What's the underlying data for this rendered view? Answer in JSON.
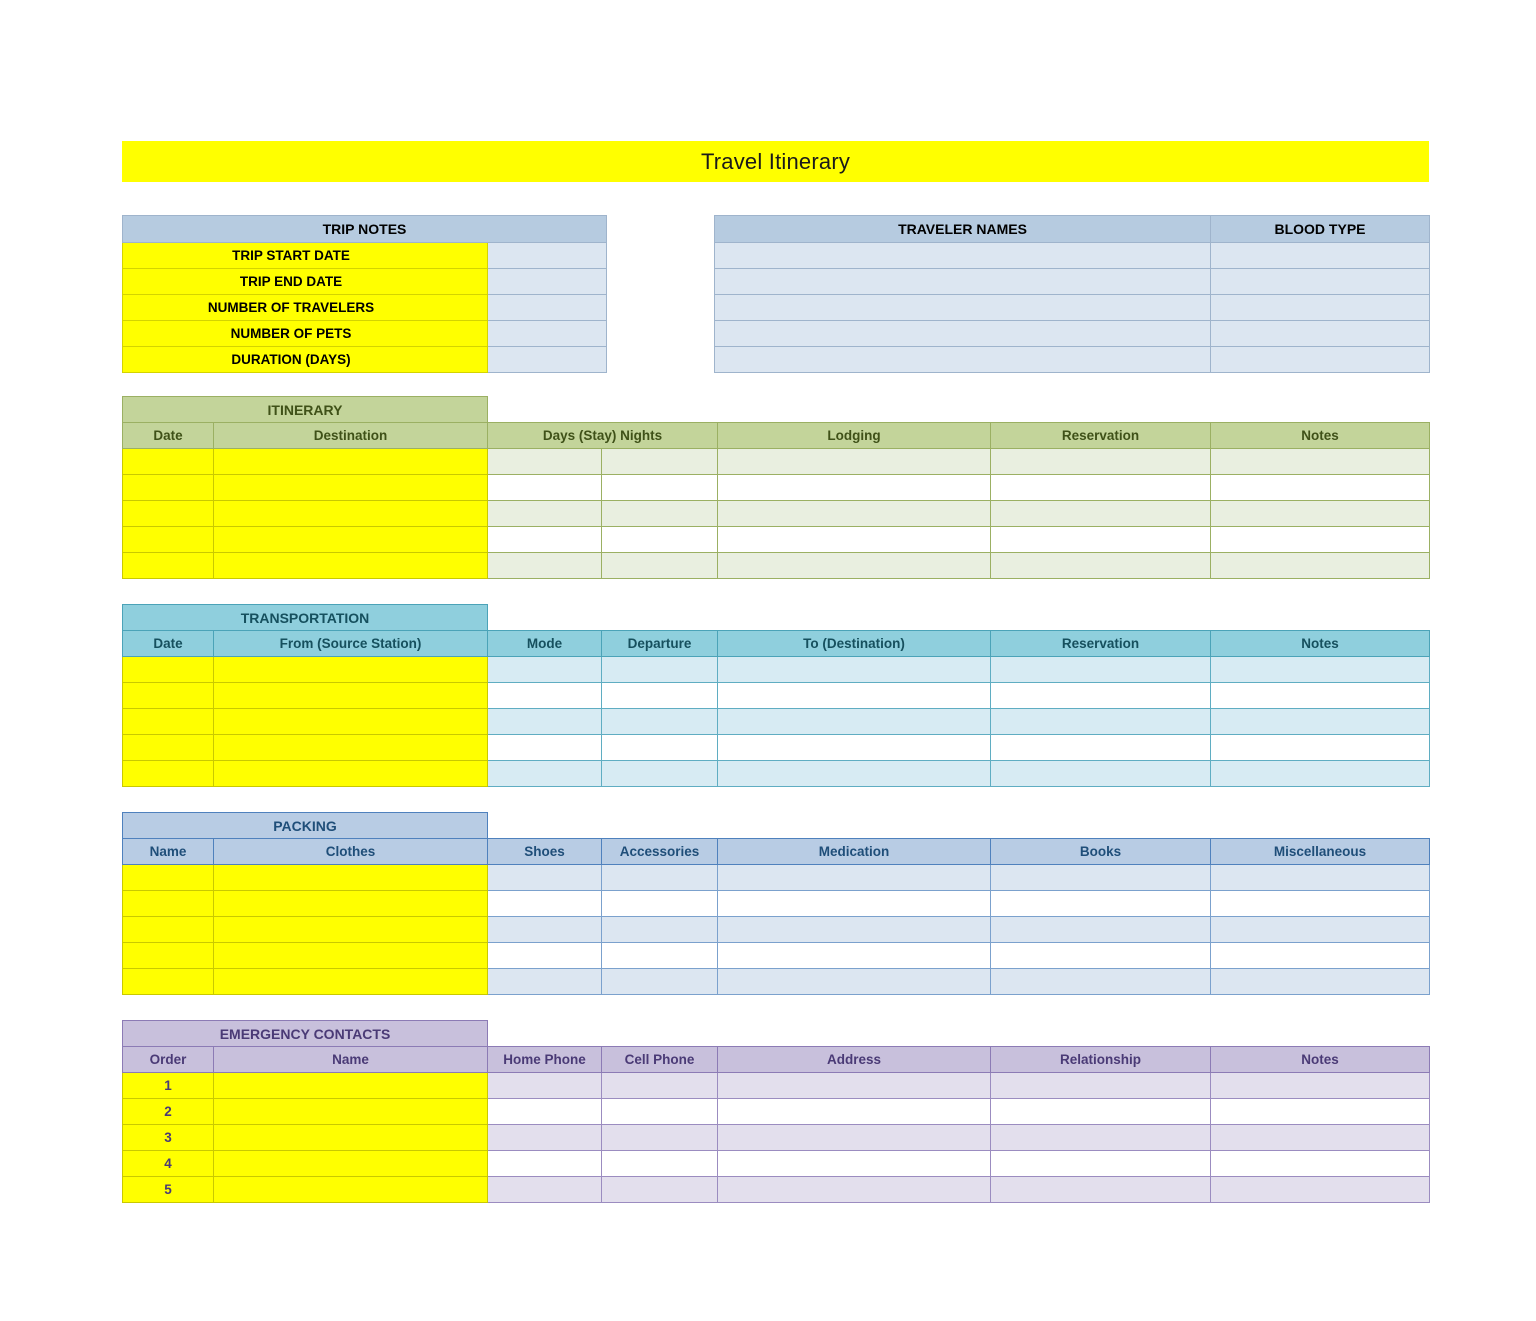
{
  "document": {
    "title": "Travel Itinerary",
    "title_bg": "#ffff00"
  },
  "trip_notes": {
    "banner": "TRIP NOTES",
    "rows": [
      {
        "label": "TRIP START DATE",
        "value": ""
      },
      {
        "label": "TRIP END DATE",
        "value": ""
      },
      {
        "label": "NUMBER OF TRAVELERS",
        "value": ""
      },
      {
        "label": "NUMBER OF PETS",
        "value": ""
      },
      {
        "label": "DURATION (DAYS)",
        "value": ""
      }
    ]
  },
  "traveler_names": {
    "headers": [
      "TRAVELER NAMES",
      "BLOOD TYPE"
    ],
    "rows": [
      {
        "name": "",
        "blood_type": ""
      },
      {
        "name": "",
        "blood_type": ""
      },
      {
        "name": "",
        "blood_type": ""
      },
      {
        "name": "",
        "blood_type": ""
      },
      {
        "name": "",
        "blood_type": ""
      }
    ]
  },
  "itinerary": {
    "banner": "ITINERARY",
    "headers": [
      "Date",
      "Destination",
      "Days (Stay) Nights",
      "Lodging",
      "Reservation",
      "Notes"
    ],
    "rows": [
      {
        "date": "",
        "destination": "",
        "days": "",
        "nights": "",
        "lodging": "",
        "reservation": "",
        "notes": ""
      },
      {
        "date": "",
        "destination": "",
        "days": "",
        "nights": "",
        "lodging": "",
        "reservation": "",
        "notes": ""
      },
      {
        "date": "",
        "destination": "",
        "days": "",
        "nights": "",
        "lodging": "",
        "reservation": "",
        "notes": ""
      },
      {
        "date": "",
        "destination": "",
        "days": "",
        "nights": "",
        "lodging": "",
        "reservation": "",
        "notes": ""
      },
      {
        "date": "",
        "destination": "",
        "days": "",
        "nights": "",
        "lodging": "",
        "reservation": "",
        "notes": ""
      }
    ]
  },
  "transportation": {
    "banner": "TRANSPORTATION",
    "headers": [
      "Date",
      "From (Source Station)",
      "Mode",
      "Departure",
      "To (Destination)",
      "Reservation",
      "Notes"
    ],
    "rows": [
      {
        "date": "",
        "from": "",
        "mode": "",
        "departure": "",
        "to": "",
        "reservation": "",
        "notes": ""
      },
      {
        "date": "",
        "from": "",
        "mode": "",
        "departure": "",
        "to": "",
        "reservation": "",
        "notes": ""
      },
      {
        "date": "",
        "from": "",
        "mode": "",
        "departure": "",
        "to": "",
        "reservation": "",
        "notes": ""
      },
      {
        "date": "",
        "from": "",
        "mode": "",
        "departure": "",
        "to": "",
        "reservation": "",
        "notes": ""
      },
      {
        "date": "",
        "from": "",
        "mode": "",
        "departure": "",
        "to": "",
        "reservation": "",
        "notes": ""
      }
    ]
  },
  "packing": {
    "banner": "PACKING",
    "headers": [
      "Name",
      "Clothes",
      "Shoes",
      "Accessories",
      "Medication",
      "Books",
      "Miscellaneous"
    ],
    "rows": [
      {
        "name": "",
        "clothes": "",
        "shoes": "",
        "accessories": "",
        "medication": "",
        "books": "",
        "misc": ""
      },
      {
        "name": "",
        "clothes": "",
        "shoes": "",
        "accessories": "",
        "medication": "",
        "books": "",
        "misc": ""
      },
      {
        "name": "",
        "clothes": "",
        "shoes": "",
        "accessories": "",
        "medication": "",
        "books": "",
        "misc": ""
      },
      {
        "name": "",
        "clothes": "",
        "shoes": "",
        "accessories": "",
        "medication": "",
        "books": "",
        "misc": ""
      },
      {
        "name": "",
        "clothes": "",
        "shoes": "",
        "accessories": "",
        "medication": "",
        "books": "",
        "misc": ""
      }
    ]
  },
  "emergency_contacts": {
    "banner": "EMERGENCY CONTACTS",
    "headers": [
      "Order",
      "Name",
      "Home Phone",
      "Cell Phone",
      "Address",
      "Relationship",
      "Notes"
    ],
    "rows": [
      {
        "order": "1",
        "name": "",
        "home_phone": "",
        "cell_phone": "",
        "address": "",
        "relationship": "",
        "notes": ""
      },
      {
        "order": "2",
        "name": "",
        "home_phone": "",
        "cell_phone": "",
        "address": "",
        "relationship": "",
        "notes": ""
      },
      {
        "order": "3",
        "name": "",
        "home_phone": "",
        "cell_phone": "",
        "address": "",
        "relationship": "",
        "notes": ""
      },
      {
        "order": "4",
        "name": "",
        "home_phone": "",
        "cell_phone": "",
        "address": "",
        "relationship": "",
        "notes": ""
      },
      {
        "order": "5",
        "name": "",
        "home_phone": "",
        "cell_phone": "",
        "address": "",
        "relationship": "",
        "notes": ""
      }
    ]
  }
}
